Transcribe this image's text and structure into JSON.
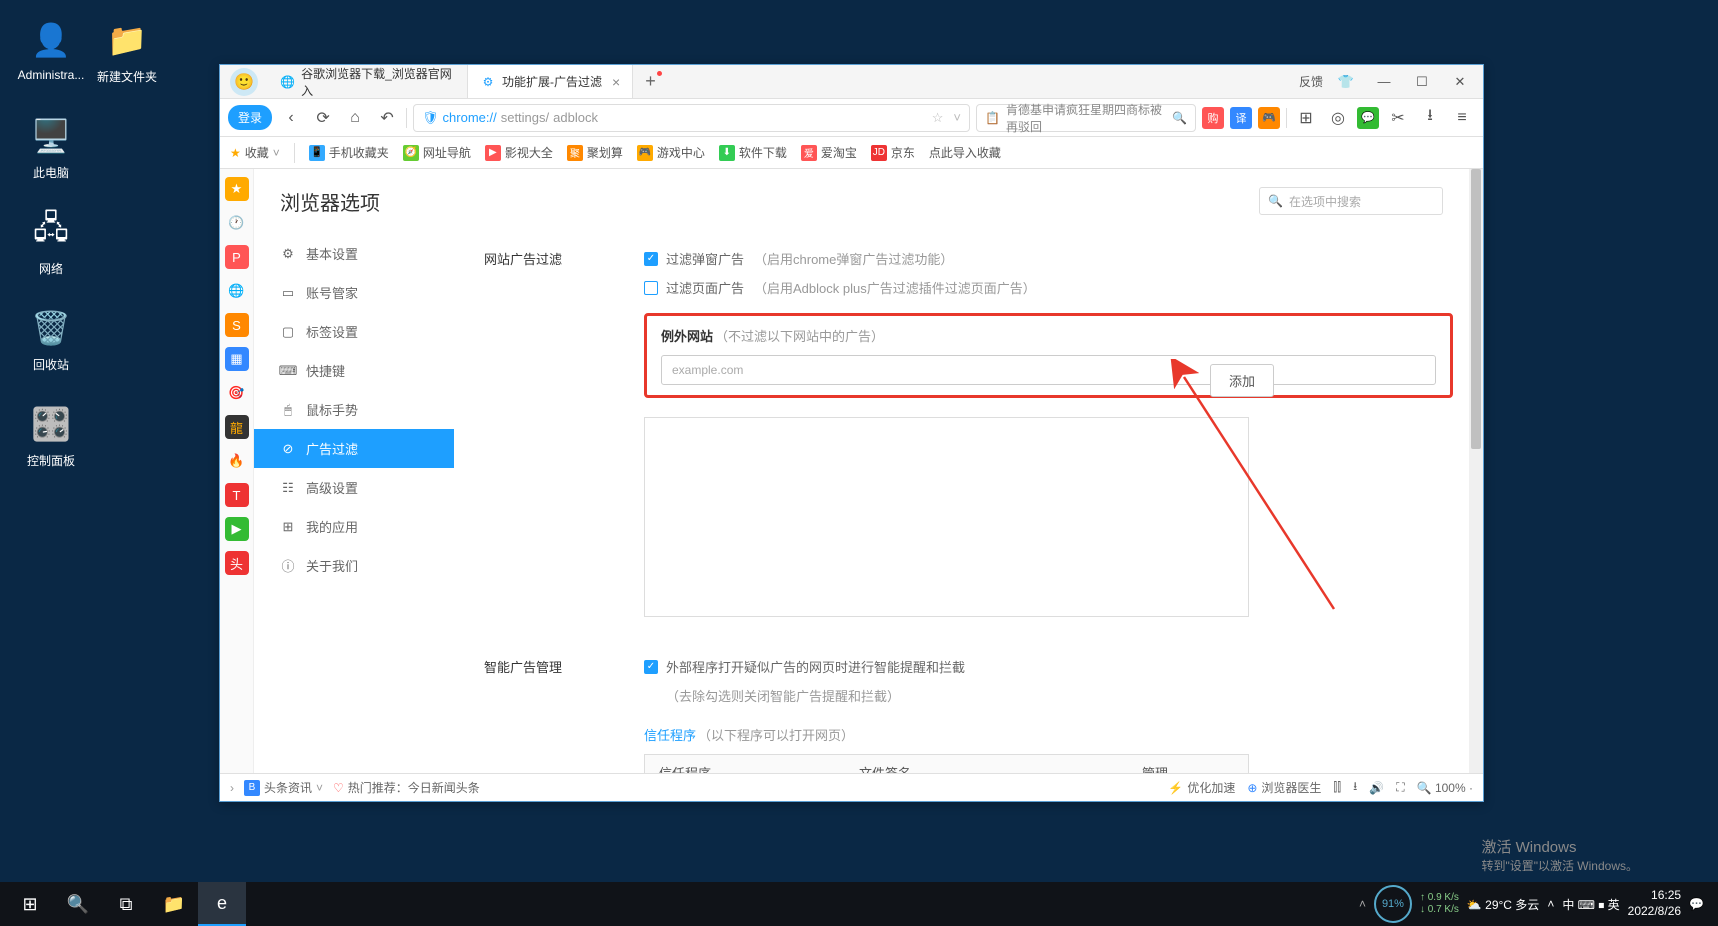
{
  "desktop": {
    "icons": [
      {
        "label": "Administra...",
        "emoji": "👤"
      },
      {
        "label": "新建文件夹",
        "emoji": "📁"
      },
      {
        "label": "此电脑",
        "emoji": "🖥️"
      },
      {
        "label": "网络",
        "emoji": "🖧"
      },
      {
        "label": "回收站",
        "emoji": "🗑️"
      },
      {
        "label": "控制面板",
        "emoji": "🎛️"
      }
    ]
  },
  "browser": {
    "tabs": [
      {
        "title": "谷歌浏览器下载_浏览器官网入",
        "active": false
      },
      {
        "title": "功能扩展-广告过滤",
        "active": true
      }
    ],
    "title_right": {
      "feedback": "反馈"
    },
    "login_label": "登录",
    "url": {
      "prefix": "chrome://",
      "path": "settings/",
      "page": "adblock"
    },
    "search_hint": "肯德基申请疯狂星期四商标被再驳回",
    "bookmarks": {
      "fav": "收藏",
      "items": [
        "手机收藏夹",
        "网址导航",
        "影视大全",
        "聚划算",
        "游戏中心",
        "软件下载",
        "爱淘宝",
        "京东",
        "点此导入收藏"
      ]
    },
    "settings": {
      "title": "浏览器选项",
      "search_placeholder": "在选项中搜索",
      "menu": [
        "基本设置",
        "账号管家",
        "标签设置",
        "快捷键",
        "鼠标手势",
        "广告过滤",
        "高级设置",
        "我的应用",
        "关于我们"
      ],
      "active_index": 5,
      "section1": {
        "label": "网站广告过滤",
        "chk1": {
          "label": "过滤弹窗广告",
          "hint": "（启用chrome弹窗广告过滤功能）"
        },
        "chk2": {
          "label": "过滤页面广告",
          "hint": "（启用Adblock plus广告过滤插件过滤页面广告）"
        },
        "exception": {
          "title": "例外网站",
          "hint": "（不过滤以下网站中的广告）",
          "placeholder": "example.com",
          "add_btn": "添加"
        }
      },
      "section2": {
        "label": "智能广告管理",
        "chk1": {
          "label": "外部程序打开疑似广告的网页时进行智能提醒和拦截",
          "hint": "（去除勾选则关闭智能广告提醒和拦截）"
        },
        "trust_label": "信任程序",
        "trust_hint": "（以下程序可以打开网页）",
        "table_headers": [
          "信任程序",
          "文件签名",
          "管理"
        ]
      }
    },
    "statusbar": {
      "news": "头条资讯",
      "hot": "热门推荐：今日新闻头条",
      "optimize": "优化加速",
      "doctor": "浏览器医生",
      "zoom": "100%"
    }
  },
  "watermark": {
    "line1": "激活 Windows",
    "line2": "转到\"设置\"以激活 Windows。"
  },
  "taskbar": {
    "weather": "29°C 多云",
    "battery": "91%",
    "net_up": "0.9 K/s",
    "net_down": "0.7 K/s",
    "ime": "中  ⌨  ⏹  英",
    "time": "16:25",
    "date": "2022/8/26"
  }
}
